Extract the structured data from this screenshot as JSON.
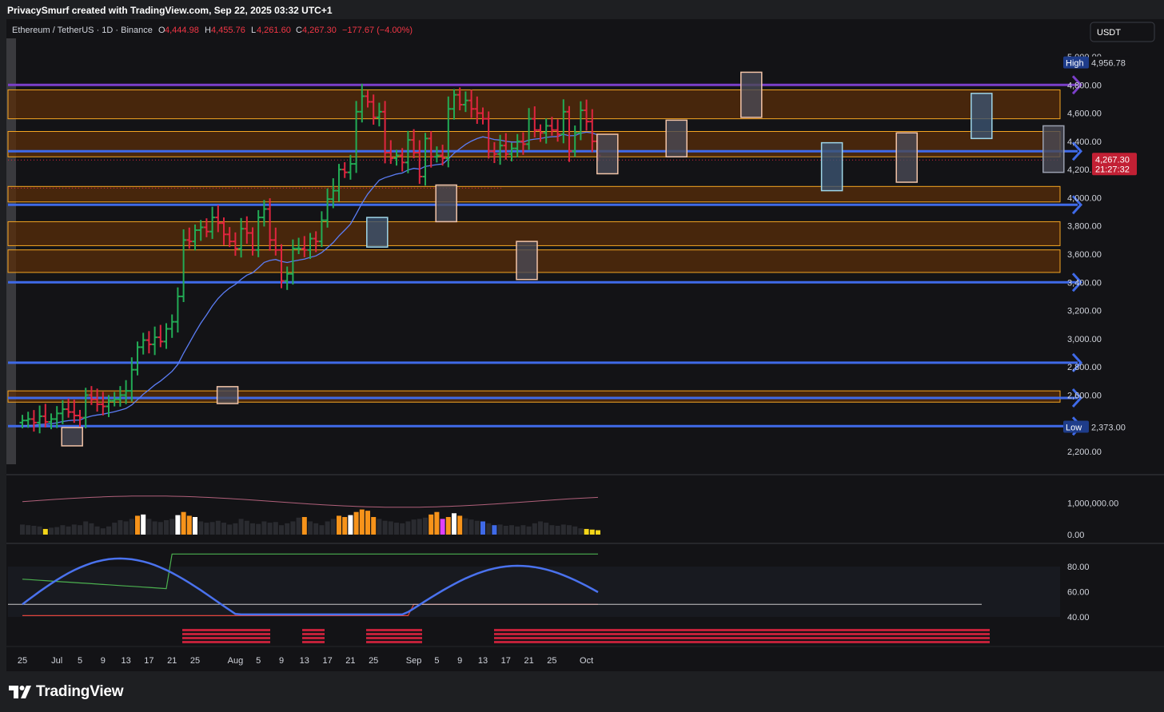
{
  "header": {
    "created_by": "PrivacySmurf created with TradingView.com, Sep 22, 2025 03:32 UTC+1"
  },
  "legend": {
    "symbol": "Ethereum / TetherUS · 1D · Binance",
    "open_label": "O",
    "open": "4,444.98",
    "high_label": "H",
    "high": "4,455.76",
    "low_label": "L",
    "low": "4,261.60",
    "close_label": "C",
    "close": "4,267.30",
    "change": "−177.67 (−4.00%)",
    "change_color": "#f23645"
  },
  "currency_button": "USDT",
  "markers": {
    "high_label": "High",
    "high_value": "4,956.78",
    "low_label": "Low",
    "low_value": "2,373.00",
    "price_value": "4,267.30",
    "price_countdown": "21:27:32"
  },
  "footer": {
    "brand": "TradingView"
  },
  "colors": {
    "up": "#22ab55",
    "down": "#e0253f",
    "ema": "#5b7df5",
    "zone_fill": "#5a2e0a",
    "zone_border": "#f5a623",
    "blue_level": "#3f6ae8",
    "purple_level": "#7b3fc9",
    "rsi_line": "#4a72ee",
    "upper_band": "#4bb04f",
    "lower_band": "#e0443c"
  },
  "chart_data": {
    "type": "candlestick",
    "title": "Ethereum / TetherUS · 1D · Binance",
    "price_axis_ticks": [
      "5,000.00",
      "4,800.00",
      "4,600.00",
      "4,400.00",
      "4,200.00",
      "4,000.00",
      "3,800.00",
      "3,600.00",
      "3,400.00",
      "3,200.00",
      "3,000.00",
      "2,800.00",
      "2,600.00",
      "2,400.00",
      "2,200.00"
    ],
    "price_axis_values": [
      5000,
      4800,
      4600,
      4400,
      4200,
      4000,
      3800,
      3600,
      3400,
      3200,
      3000,
      2800,
      2600,
      2400,
      2200
    ],
    "ylim": [
      2150,
      5050
    ],
    "x_ticks": [
      "25",
      "Jul",
      "5",
      "9",
      "13",
      "17",
      "21",
      "25",
      "Aug",
      "5",
      "9",
      "13",
      "17",
      "21",
      "25",
      "Sep",
      "5",
      "9",
      "13",
      "17",
      "21",
      "25",
      "Oct"
    ],
    "x_tick_days": [
      0,
      6,
      10,
      14,
      18,
      22,
      26,
      30,
      37,
      41,
      45,
      49,
      53,
      57,
      61,
      68,
      72,
      76,
      80,
      84,
      88,
      92,
      98
    ],
    "closes": [
      2420,
      2430,
      2405,
      2450,
      2410,
      2430,
      2470,
      2500,
      2480,
      2455,
      2440,
      2600,
      2570,
      2535,
      2520,
      2560,
      2570,
      2600,
      2630,
      2780,
      2940,
      2990,
      2960,
      3010,
      2980,
      3070,
      3120,
      3300,
      3700,
      3690,
      3770,
      3790,
      3760,
      3860,
      3820,
      3740,
      3690,
      3640,
      3780,
      3750,
      3630,
      3860,
      3920,
      3700,
      3630,
      3410,
      3460,
      3640,
      3640,
      3630,
      3710,
      3690,
      3840,
      3990,
      4050,
      4200,
      4180,
      4240,
      4610,
      4720,
      4680,
      4570,
      4610,
      4320,
      4280,
      4300,
      4250,
      4410,
      4320,
      4150,
      4420,
      4290,
      4300,
      4280,
      4630,
      4730,
      4660,
      4690,
      4630,
      4600,
      4560,
      4330,
      4310,
      4370,
      4310,
      4350,
      4400,
      4380,
      4560,
      4480,
      4460,
      4510,
      4480,
      4450,
      4610,
      4330,
      4460,
      4620,
      4540,
      4400,
      4300
    ],
    "levels": {
      "purple": [
        4800
      ],
      "blue": [
        3950,
        3400,
        2830,
        2580,
        2380,
        4330
      ]
    },
    "zones": [
      {
        "low": 4560,
        "high": 4765
      },
      {
        "low": 4290,
        "high": 4470
      },
      {
        "low": 3970,
        "high": 4080
      },
      {
        "low": 3660,
        "high": 3830
      },
      {
        "low": 3470,
        "high": 3630
      },
      {
        "low": 2550,
        "high": 2630
      }
    ],
    "volume_axis_ticks": [
      "1,000,000.00",
      "0.00"
    ],
    "volume_axis_values": [
      1000000,
      0
    ],
    "volumes": [
      320000,
      300000,
      280000,
      260000,
      180000,
      220000,
      240000,
      300000,
      260000,
      320000,
      300000,
      420000,
      360000,
      260000,
      200000,
      260000,
      380000,
      460000,
      420000,
      500000,
      600000,
      640000,
      500000,
      420000,
      400000,
      460000,
      500000,
      620000,
      720000,
      600000,
      560000,
      420000,
      380000,
      400000,
      440000,
      380000,
      320000,
      360000,
      500000,
      440000,
      360000,
      340000,
      420000,
      380000,
      400000,
      300000,
      360000,
      420000,
      540000,
      560000,
      420000,
      360000,
      300000,
      420000,
      500000,
      600000,
      560000,
      620000,
      720000,
      800000,
      760000,
      560000,
      500000,
      440000,
      420000,
      380000,
      360000,
      420000,
      480000,
      500000,
      540000,
      640000,
      720000,
      500000,
      560000,
      680000,
      600000,
      520000,
      480000,
      440000,
      420000,
      360000,
      300000,
      320000,
      280000,
      300000,
      260000,
      300000,
      260000,
      360000,
      420000,
      380000,
      300000,
      280000,
      320000,
      300000,
      260000,
      200000,
      180000,
      160000,
      140000
    ],
    "oscillator_axis_ticks": [
      "80.00",
      "60.00",
      "40.00"
    ],
    "oscillator_axis_values": [
      80,
      60,
      40
    ]
  }
}
